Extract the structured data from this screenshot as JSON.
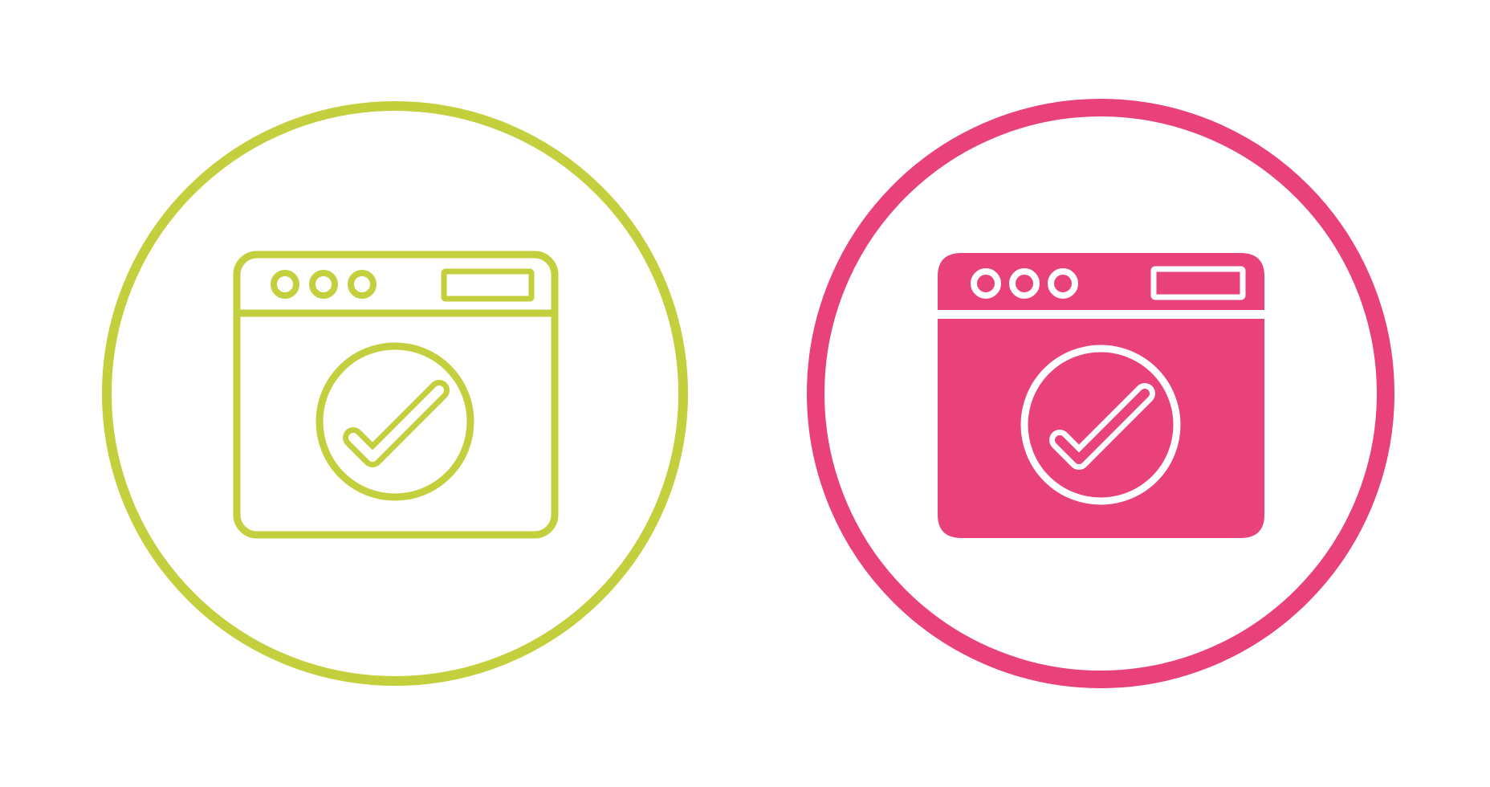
{
  "icons": [
    {
      "id": "line-style",
      "semantic": "browser-window-check-icon",
      "style": "outline",
      "color": "#c3cf3c"
    },
    {
      "id": "filled-style",
      "semantic": "browser-window-check-icon",
      "style": "filled",
      "color": "#e9417a"
    }
  ]
}
